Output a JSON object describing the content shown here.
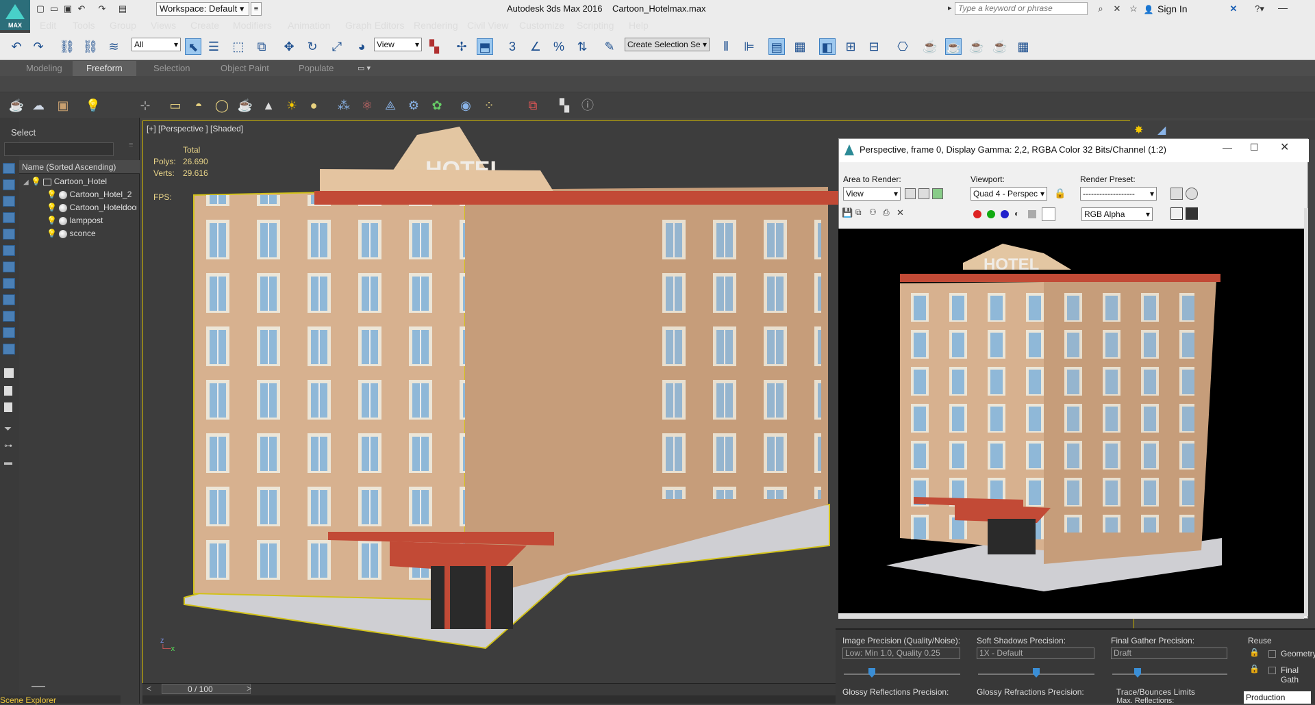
{
  "app": {
    "logo_label": "MAX",
    "title": "Autodesk 3ds Max 2016",
    "filename": "Cartoon_Hotelmax.max",
    "workspace": "Workspace: Default",
    "search_placeholder": "Type a keyword or phrase",
    "signin": "Sign In"
  },
  "menu": [
    "Edit",
    "Tools",
    "Group",
    "Views",
    "Create",
    "Modifiers",
    "Animation",
    "Graph Editors",
    "Rendering",
    "Civil View",
    "Customize",
    "Scripting",
    "Help"
  ],
  "toolbar": {
    "filter": "All",
    "refcoord": "View",
    "selection_set": "Create Selection Se",
    "snap_label": "3"
  },
  "ribbon_tabs": [
    "Modeling",
    "Freeform",
    "Selection",
    "Object Paint",
    "Populate"
  ],
  "ribbon_active": "Freeform",
  "scene_explorer": {
    "select_label": "Select",
    "sort_header": "Name (Sorted Ascending)",
    "items": [
      "Cartoon_Hotel",
      "Cartoon_Hotel_2",
      "Cartoon_Hoteldoor",
      "lamppost",
      "sconce"
    ],
    "footer": "Scene Explorer"
  },
  "viewport": {
    "label": "[+] [Perspective ] [Shaded]",
    "stats_header": "Total",
    "polys_label": "Polys:",
    "polys_value": "26.690",
    "verts_label": "Verts:",
    "verts_value": "29.616",
    "fps_label": "FPS:",
    "hotel_sign": "HOTEL",
    "time_slider": "0 / 100"
  },
  "render_window": {
    "title": "Perspective, frame 0, Display Gamma: 2,2, RGBA Color 32 Bits/Channel (1:2)",
    "area_label": "Area to Render:",
    "area_value": "View",
    "viewport_label": "Viewport:",
    "viewport_value": "Quad 4 - Perspec",
    "preset_label": "Render Preset:",
    "preset_value": "-------------------",
    "channel_value": "RGB Alpha",
    "hotel_sign": "HOTEL"
  },
  "render_settings": {
    "image_precision_label": "Image Precision (Quality/Noise):",
    "image_precision_value": "Low: Min 1.0, Quality 0.25",
    "soft_shadows_label": "Soft Shadows Precision:",
    "soft_shadows_value": "1X - Default",
    "final_gather_label": "Final Gather Precision:",
    "final_gather_value": "Draft",
    "reuse_label": "Reuse",
    "geometry_label": "Geometry",
    "final_gath_label": "Final Gath",
    "glossy_refl_label": "Glossy Reflections Precision:",
    "glossy_refr_label": "Glossy Refractions Precision:",
    "trace_label": "Trace/Bounces Limits",
    "max_refl_label": "Max. Reflections:",
    "production": "Production"
  },
  "colors": {
    "accent": "#3c7fc2",
    "selection_outline": "#c8b000",
    "viewport_bg": "#3d3d3d"
  }
}
